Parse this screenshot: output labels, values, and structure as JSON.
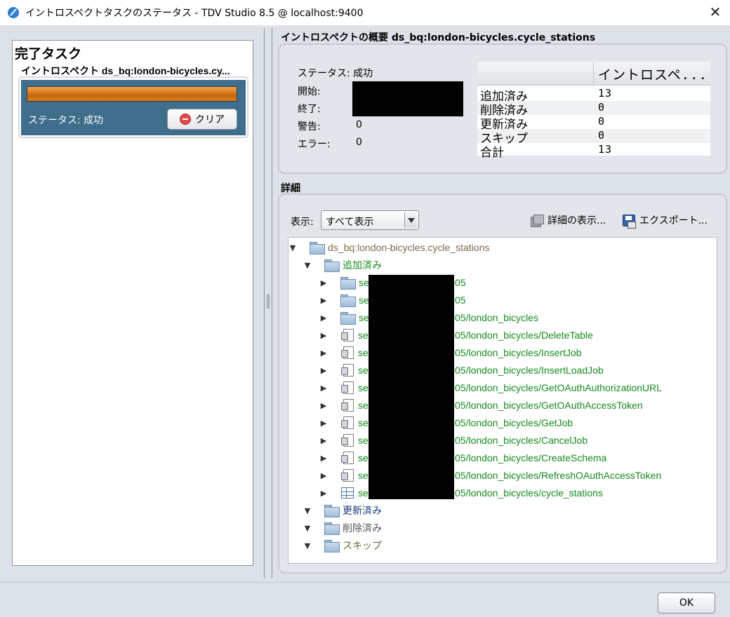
{
  "window": {
    "title": "イントロスペクトタスクのステータス - TDV Studio 8.5 @ localhost:9400",
    "close_glyph": "✕"
  },
  "left": {
    "heading": "完了タスク",
    "task": {
      "name": "イントロスペクト ds_bq:london-bicycles.cy...",
      "progress_percent": 100,
      "status": "ステータス: 成功",
      "clear_label": "クリア"
    }
  },
  "summary": {
    "title": "イントロスペクトの概要  ds_bq:london-bicycles.cycle_stations",
    "status": "ステータス: 成功",
    "start_label": "開始:",
    "end_label": "終了:",
    "warning_label": "警告:",
    "warning_value": "0",
    "error_label": "エラー:",
    "error_value": "0",
    "table": {
      "header": "イントロスペ...",
      "rows": [
        {
          "label": "追加済み",
          "value": "13"
        },
        {
          "label": "削除済み",
          "value": "0"
        },
        {
          "label": "更新済み",
          "value": "0"
        },
        {
          "label": "スキップ",
          "value": "0"
        },
        {
          "label": "合計",
          "value": "13"
        }
      ]
    }
  },
  "details": {
    "title": "詳細",
    "show_label": "表示:",
    "show_value": "すべて表示",
    "view_details_label": "詳細の表示...",
    "export_label": "エクスポート...",
    "tree": {
      "root": "ds_bq:london-bicycles.cycle_stations",
      "added": "追加済み",
      "items": [
        {
          "prefix": "se",
          "suffix": "05"
        },
        {
          "prefix": "se",
          "suffix": "05"
        },
        {
          "prefix": "se",
          "suffix": "05/london_bicycles"
        },
        {
          "prefix": "se",
          "suffix": "05/london_bicycles/DeleteTable"
        },
        {
          "prefix": "se",
          "suffix": "05/london_bicycles/InsertJob"
        },
        {
          "prefix": "se",
          "suffix": "05/london_bicycles/InsertLoadJob"
        },
        {
          "prefix": "se",
          "suffix": "05/london_bicycles/GetOAuthAuthorizationURL"
        },
        {
          "prefix": "se",
          "suffix": "05/london_bicycles/GetOAuthAccessToken"
        },
        {
          "prefix": "se",
          "suffix": "05/london_bicycles/GetJob"
        },
        {
          "prefix": "se",
          "suffix": "05/london_bicycles/CancelJob"
        },
        {
          "prefix": "se",
          "suffix": "05/london_bicycles/CreateSchema"
        },
        {
          "prefix": "se",
          "suffix": "05/london_bicycles/RefreshOAuthAccessToken"
        },
        {
          "prefix": "se",
          "suffix": "05/london_bicycles/cycle_stations"
        }
      ],
      "updated": "更新済み",
      "deleted": "削除済み",
      "skipped": "スキップ"
    }
  },
  "ok_label": "OK"
}
